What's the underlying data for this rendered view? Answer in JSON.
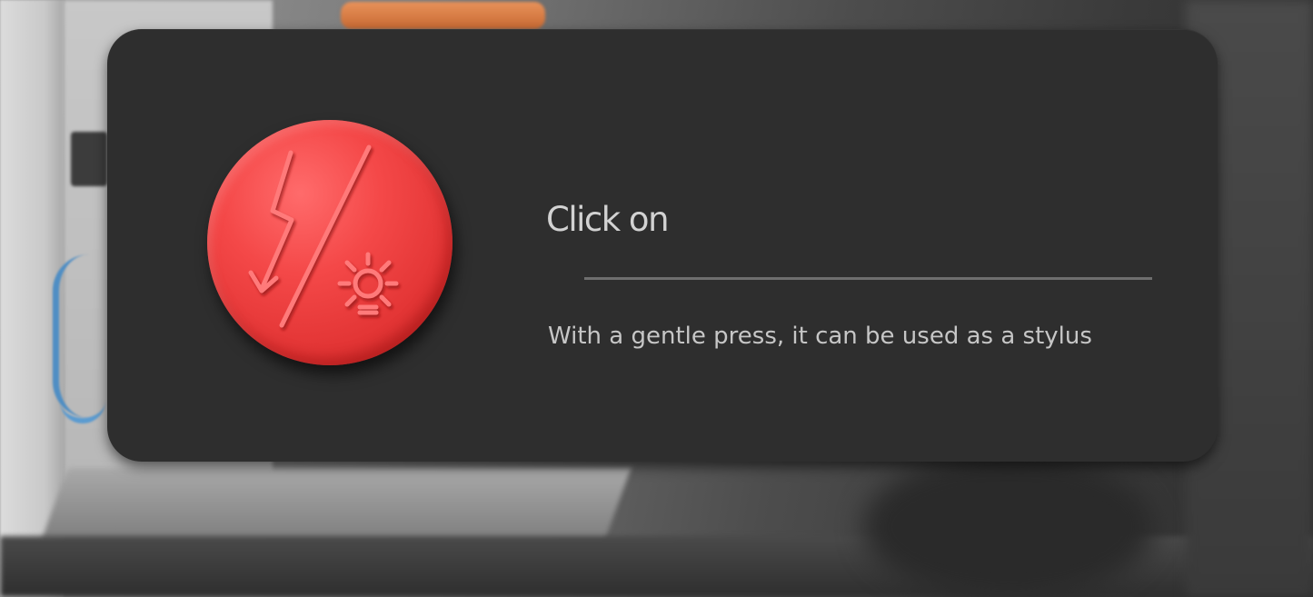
{
  "card": {
    "title": "Click on",
    "description": "With a gentle press, it can be used as a stylus"
  },
  "badge": {
    "icon": "electrical-hazard-light-icon",
    "color": "#f04444"
  }
}
